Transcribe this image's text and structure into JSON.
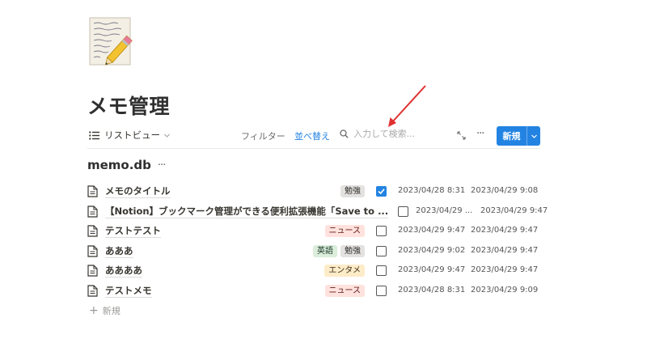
{
  "page": {
    "icon": "memo-pencil-icon",
    "title": "メモ管理"
  },
  "toolbar": {
    "view_label": "リストビュー",
    "filter_label": "フィルター",
    "sort_label": "並べ替え",
    "search_placeholder": "入力して検索...",
    "new_label": "新規",
    "accent_color": "#2383e2"
  },
  "database": {
    "title": "memo.db",
    "more": "···",
    "rows": [
      {
        "title": "メモのタイトル",
        "tags": [
          {
            "label": "勉強",
            "bg": "#e3e2e0",
            "fg": "#32302c"
          }
        ],
        "checked": true,
        "created": "2023/04/28 8:31",
        "edited": "2023/04/29 9:08"
      },
      {
        "title": "【Notion】ブックマーク管理ができる便利拡張機能「Save to ...",
        "tags": [],
        "checked": false,
        "created": "2023/04/29 ...",
        "edited": "2023/04/29 9:47"
      },
      {
        "title": "テストテスト",
        "tags": [
          {
            "label": "ニュース",
            "bg": "#ffe2dd",
            "fg": "#5d1715"
          }
        ],
        "checked": false,
        "created": "2023/04/29 9:47",
        "edited": "2023/04/29 9:47"
      },
      {
        "title": "あああ",
        "tags": [
          {
            "label": "英語",
            "bg": "#dbeddb",
            "fg": "#1c3829"
          },
          {
            "label": "勉強",
            "bg": "#e3e2e0",
            "fg": "#32302c"
          }
        ],
        "checked": false,
        "created": "2023/04/29 9:02",
        "edited": "2023/04/29 9:47"
      },
      {
        "title": "ああああ",
        "tags": [
          {
            "label": "エンタメ",
            "bg": "#fdecc8",
            "fg": "#402c1b"
          }
        ],
        "checked": false,
        "created": "2023/04/29 9:47",
        "edited": "2023/04/29 9:47"
      },
      {
        "title": "テストメモ",
        "tags": [
          {
            "label": "ニュース",
            "bg": "#ffe2dd",
            "fg": "#5d1715"
          }
        ],
        "checked": false,
        "created": "2023/04/28 8:31",
        "edited": "2023/04/29 9:09"
      }
    ],
    "add_new_label": "新規"
  },
  "annotation": {
    "arrow_color": "#e03131"
  }
}
